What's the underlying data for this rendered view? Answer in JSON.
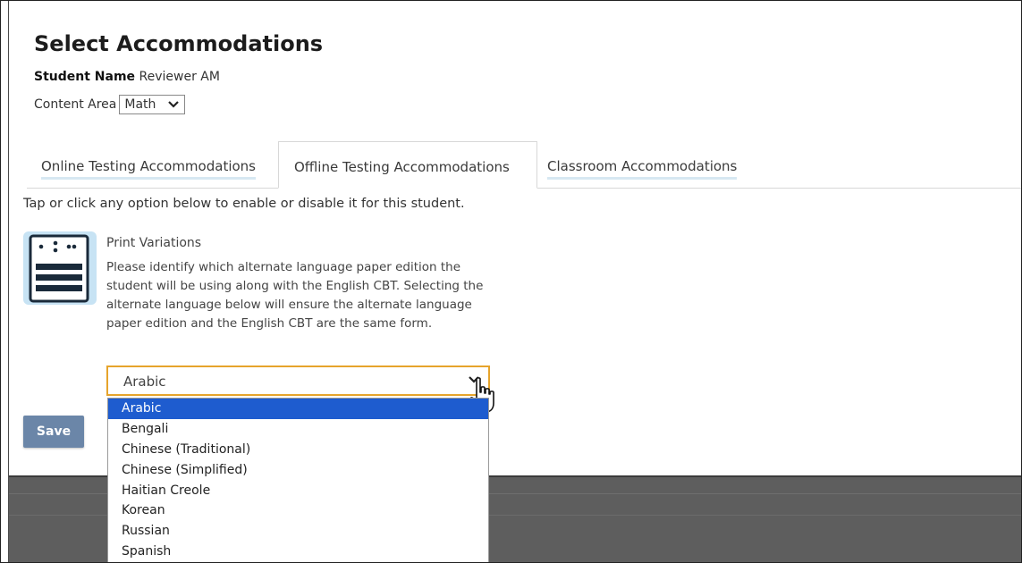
{
  "page": {
    "title": "Select Accommodations"
  },
  "student": {
    "label": "Student Name",
    "value": "Reviewer AM"
  },
  "content_area": {
    "label": "Content Area",
    "selected": "Math"
  },
  "tabs": [
    {
      "label": "Online Testing Accommodations",
      "active": false
    },
    {
      "label": "Offline Testing Accommodations",
      "active": true
    },
    {
      "label": "Classroom Accommodations",
      "active": false
    }
  ],
  "instructions": "Tap or click any option below to enable or disable it for this student.",
  "accommodation": {
    "title": "Print Variations",
    "description": "Please identify which alternate language paper edition the student will be using along with the English CBT. Selecting the alternate language below will ensure the alternate language paper edition and the English CBT are the same form.",
    "icon": "print-variations-icon",
    "selected_language": "Arabic",
    "options": [
      "Arabic",
      "Bengali",
      "Chinese (Traditional)",
      "Chinese (Simplified)",
      "Haitian Creole",
      "Korean",
      "Russian",
      "Spanish"
    ]
  },
  "buttons": {
    "save": "Save"
  },
  "colors": {
    "highlight": "#1e5ccf",
    "focus_border": "#e6a42c",
    "save_button": "#6b86a8",
    "icon_bg": "#c7e3f4",
    "tab_underline": "#d7e8f2"
  }
}
